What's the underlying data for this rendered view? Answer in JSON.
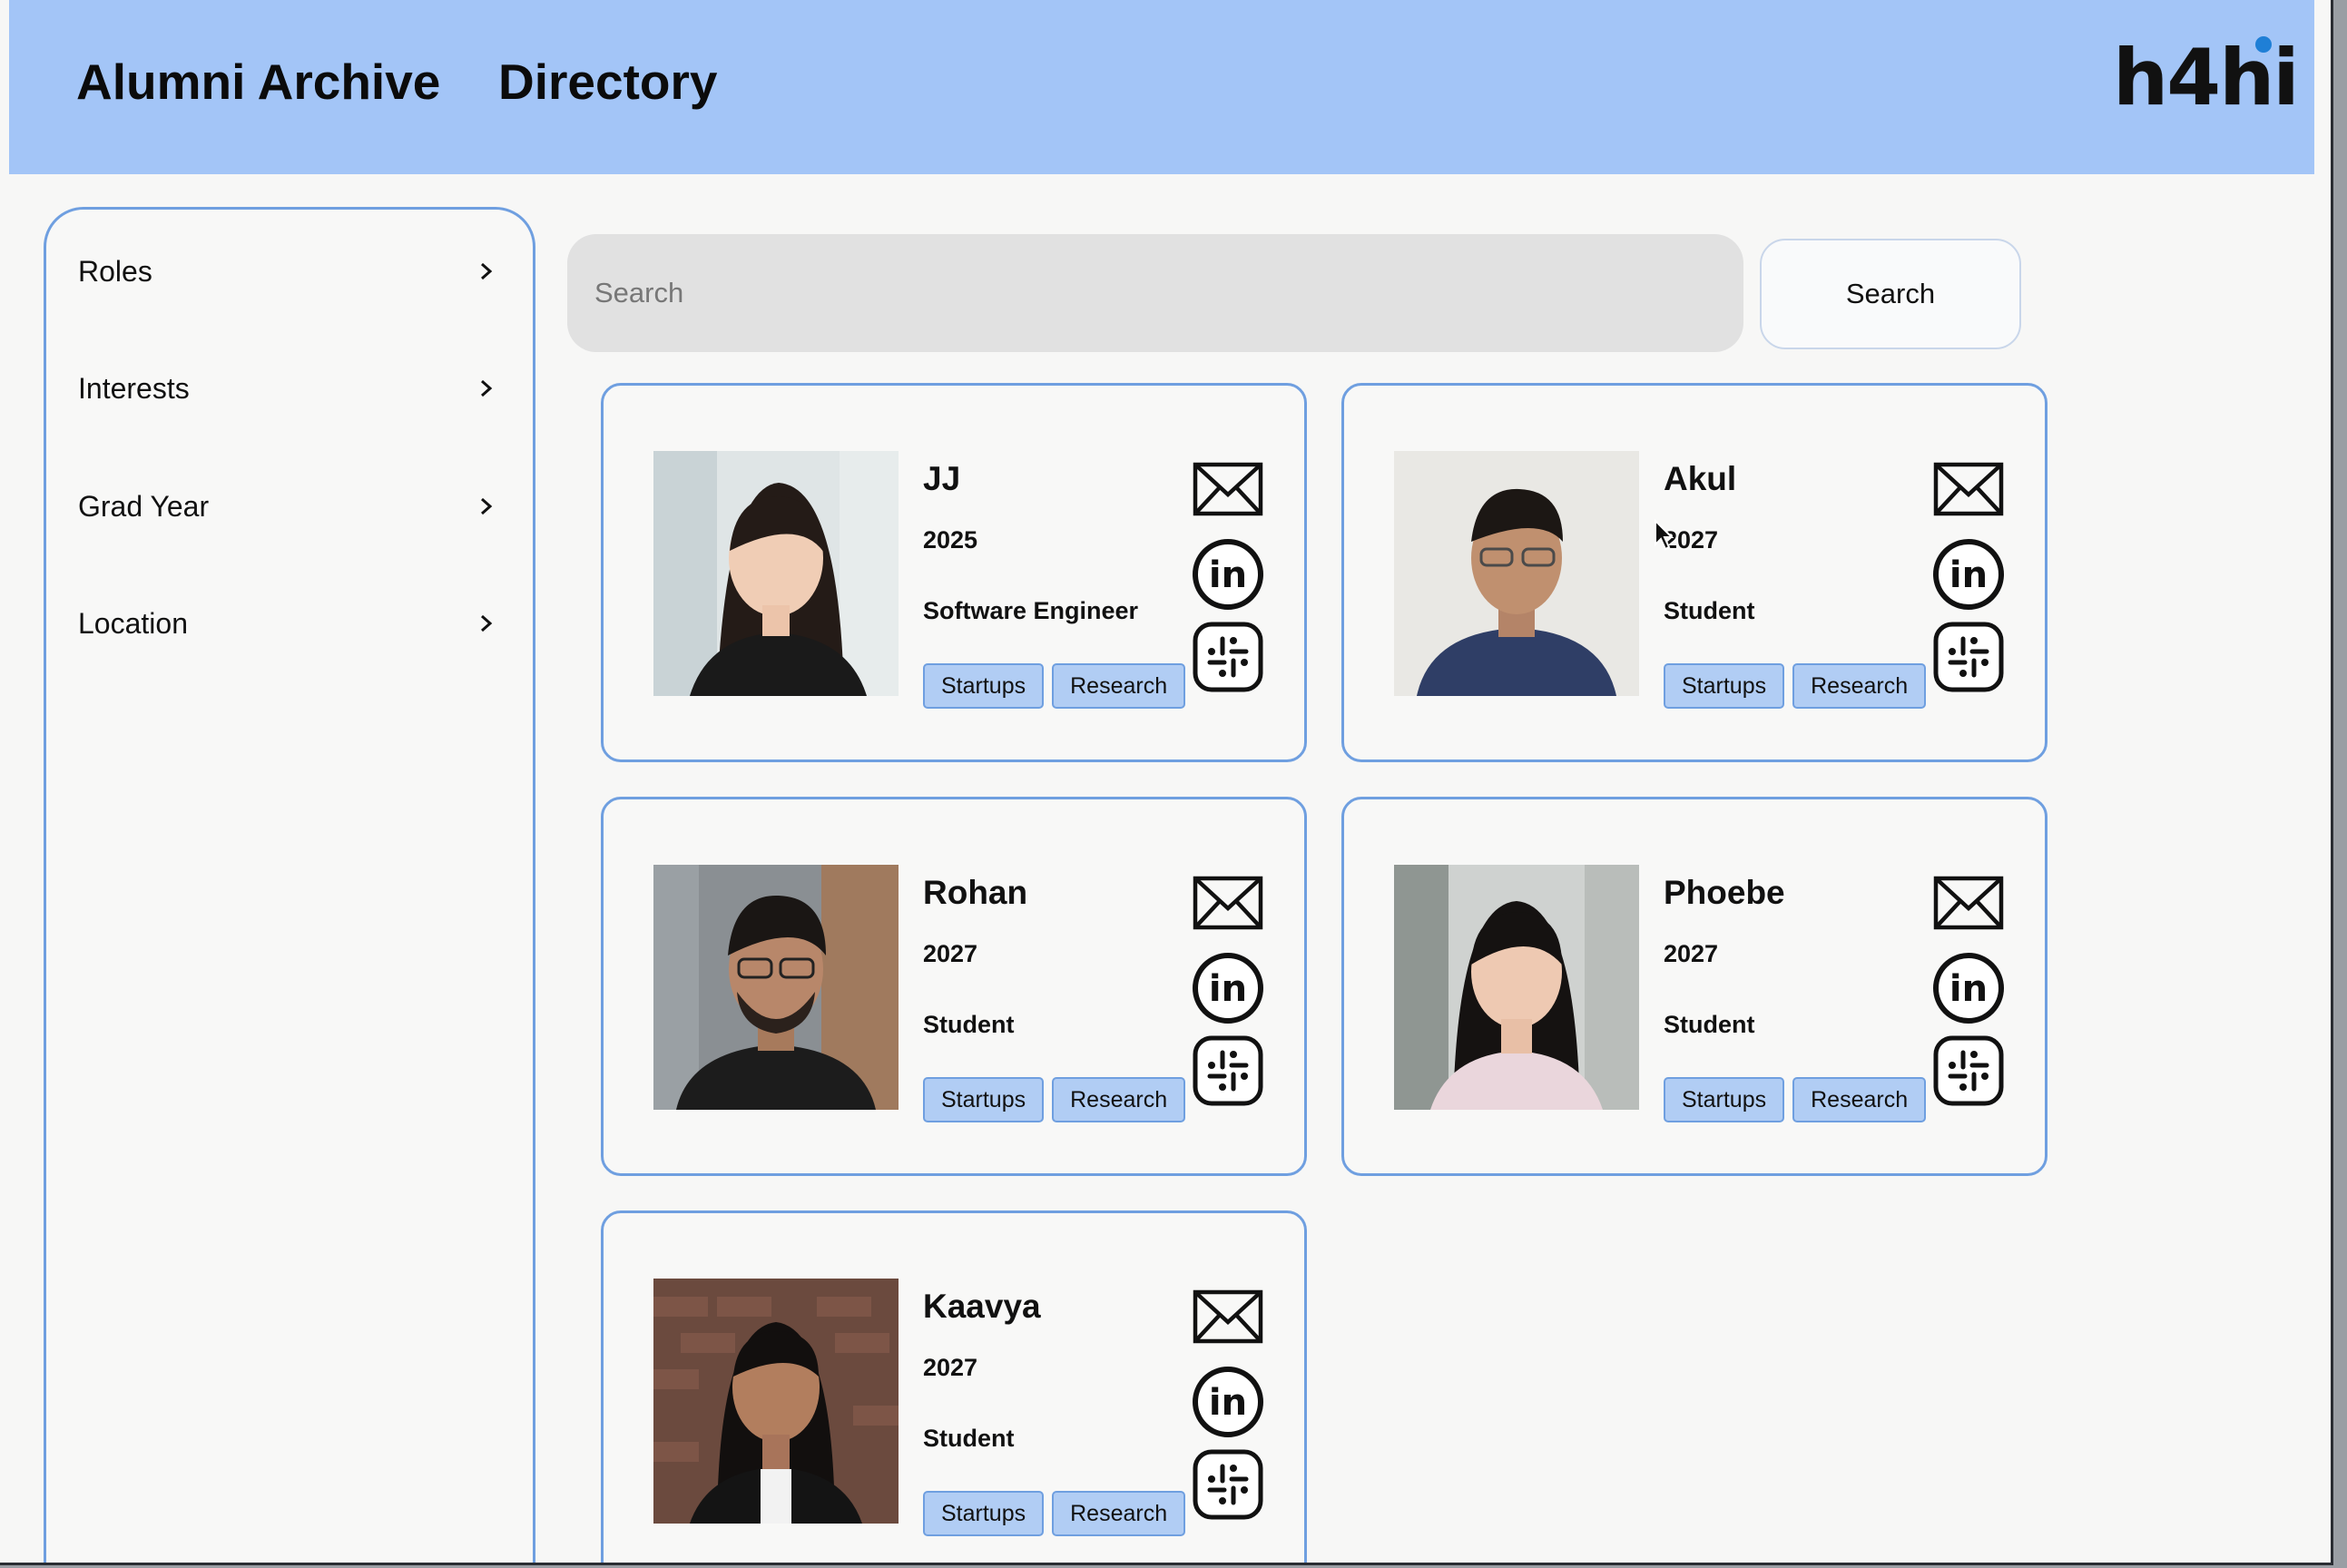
{
  "header": {
    "nav_archive": "Alumni Archive",
    "nav_directory": "Directory",
    "logo_text": "h4hi"
  },
  "sidebar": {
    "items": [
      {
        "label": "Roles"
      },
      {
        "label": "Interests"
      },
      {
        "label": "Grad Year"
      },
      {
        "label": "Location"
      }
    ]
  },
  "search": {
    "placeholder": "Search",
    "button_label": "Search"
  },
  "profiles": [
    {
      "name": "JJ",
      "year": "2025",
      "role": "Software Engineer",
      "tags": [
        "Startups",
        "Research"
      ]
    },
    {
      "name": "Akul",
      "year": "2027",
      "role": "Student",
      "tags": [
        "Startups",
        "Research"
      ]
    },
    {
      "name": "Rohan",
      "year": "2027",
      "role": "Student",
      "tags": [
        "Startups",
        "Research"
      ]
    },
    {
      "name": "Phoebe",
      "year": "2027",
      "role": "Student",
      "tags": [
        "Startups",
        "Research"
      ]
    },
    {
      "name": "Kaavya",
      "year": "2027",
      "role": "Student",
      "tags": [
        "Startups",
        "Research"
      ]
    }
  ],
  "colors": {
    "header_bg": "#a3c5f7",
    "accent_border": "#6f9fe0",
    "tag_bg": "#b1cdf4",
    "search_field_bg": "#e1e1e1"
  },
  "icons": [
    "mail-icon",
    "linkedin-icon",
    "slack-icon",
    "chevron-right-icon"
  ]
}
